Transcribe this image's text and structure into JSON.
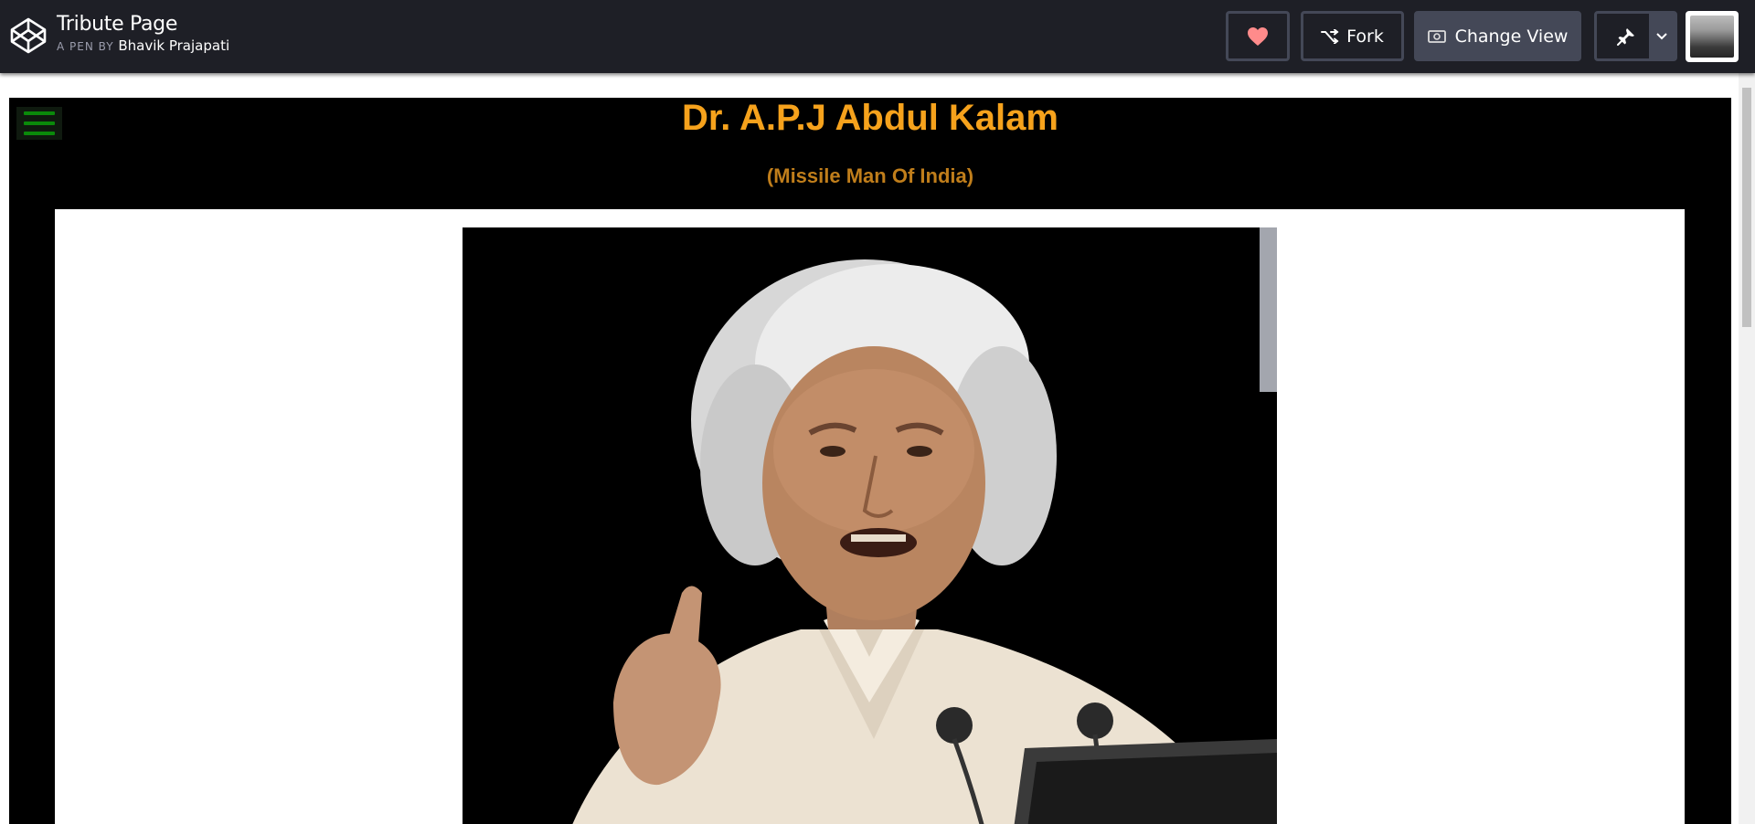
{
  "header": {
    "pen_title": "Tribute Page",
    "pen_by_prefix": "A PEN BY",
    "author": "Bhavik Prajapati",
    "fork_label": "Fork",
    "change_view_label": "Change View",
    "heart_color": "#ff8b8b"
  },
  "content": {
    "title": "Dr. A.P.J Abdul Kalam",
    "subtitle": "(Missile Man Of India)"
  },
  "colors": {
    "topbar": "#1e1f26",
    "title": "#f6a21c",
    "subtitle": "#c07e1b",
    "menu": "#0a8a0a"
  }
}
